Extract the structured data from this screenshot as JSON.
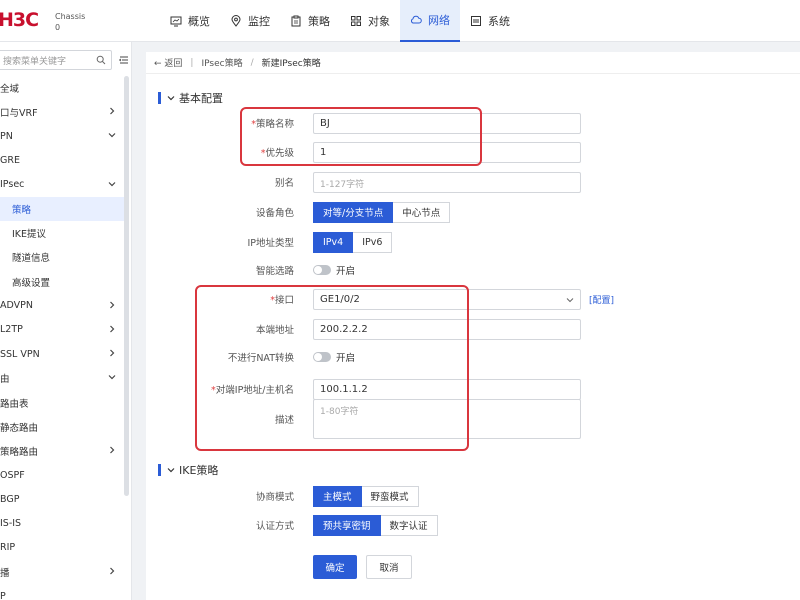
{
  "header": {
    "logo": "H3C",
    "chassis_line1": "Chassis",
    "chassis_line2": "0",
    "nav": [
      {
        "label": "概览",
        "icon": "monitor-icon"
      },
      {
        "label": "监控",
        "icon": "location-icon"
      },
      {
        "label": "策略",
        "icon": "clipboard-icon"
      },
      {
        "label": "对象",
        "icon": "grid-icon"
      },
      {
        "label": "网络",
        "icon": "cloud-icon",
        "active": true
      },
      {
        "label": "系统",
        "icon": "system-icon"
      }
    ]
  },
  "sidebar": {
    "search_placeholder": "搜索菜单关键字",
    "items": [
      {
        "label": "全域",
        "level": 0
      },
      {
        "label": "口与VRF",
        "level": 0,
        "chevron": "right"
      },
      {
        "label": "PN",
        "level": 0,
        "chevron": "down"
      },
      {
        "label": "GRE",
        "level": 1
      },
      {
        "label": "IPsec",
        "level": 1,
        "chevron": "down"
      },
      {
        "label": "策略",
        "level": 2,
        "active": true
      },
      {
        "label": "IKE提议",
        "level": 2
      },
      {
        "label": "隧道信息",
        "level": 2
      },
      {
        "label": "高级设置",
        "level": 2
      },
      {
        "label": "ADVPN",
        "level": 1,
        "chevron": "right"
      },
      {
        "label": "L2TP",
        "level": 1,
        "chevron": "right"
      },
      {
        "label": "SSL VPN",
        "level": 1,
        "chevron": "right"
      },
      {
        "label": "由",
        "level": 0,
        "chevron": "down"
      },
      {
        "label": "路由表",
        "level": 1
      },
      {
        "label": "静态路由",
        "level": 1
      },
      {
        "label": "策略路由",
        "level": 1,
        "chevron": "right"
      },
      {
        "label": "OSPF",
        "level": 1
      },
      {
        "label": "BGP",
        "level": 1
      },
      {
        "label": "IS-IS",
        "level": 1
      },
      {
        "label": "RIP",
        "level": 1
      },
      {
        "label": "播",
        "level": 0,
        "chevron": "right"
      },
      {
        "label": "P",
        "level": 0
      }
    ]
  },
  "breadcrumb": {
    "back": "返回",
    "parent": "IPsec策略",
    "separator": "/",
    "current": "新建IPsec策略"
  },
  "basic": {
    "title": "基本配置",
    "policy_name": {
      "label": "策略名称",
      "value": "BJ"
    },
    "priority": {
      "label": "优先级",
      "value": "1"
    },
    "alias": {
      "label": "别名",
      "placeholder": "1-127字符"
    },
    "device_role": {
      "label": "设备角色",
      "options": [
        "对等/分支节点",
        "中心节点"
      ]
    },
    "ip_type": {
      "label": "IP地址类型",
      "options": [
        "IPv4",
        "IPv6"
      ]
    },
    "smart_route": {
      "label": "智能选路",
      "toggle_text": "开启"
    },
    "interface": {
      "label": "接口",
      "value": "GE1/0/2",
      "link": "[配置]"
    },
    "local_addr": {
      "label": "本端地址",
      "value": "200.2.2.2"
    },
    "no_nat": {
      "label": "不进行NAT转换",
      "toggle_text": "开启"
    },
    "peer_addr": {
      "label": "对端IP地址/主机名",
      "value": "100.1.1.2"
    },
    "desc": {
      "label": "描述",
      "placeholder": "1-80字符"
    }
  },
  "ike": {
    "title": "IKE策略",
    "negotiation": {
      "label": "协商模式",
      "options": [
        "主模式",
        "野蛮模式"
      ]
    },
    "auth": {
      "label": "认证方式",
      "options": [
        "预共享密钥",
        "数字认证"
      ]
    }
  },
  "actions": {
    "ok": "确定",
    "cancel": "取消"
  },
  "colors": {
    "accent": "#2b5cd6",
    "highlight": "#d9363e",
    "logo": "#c8102e"
  }
}
